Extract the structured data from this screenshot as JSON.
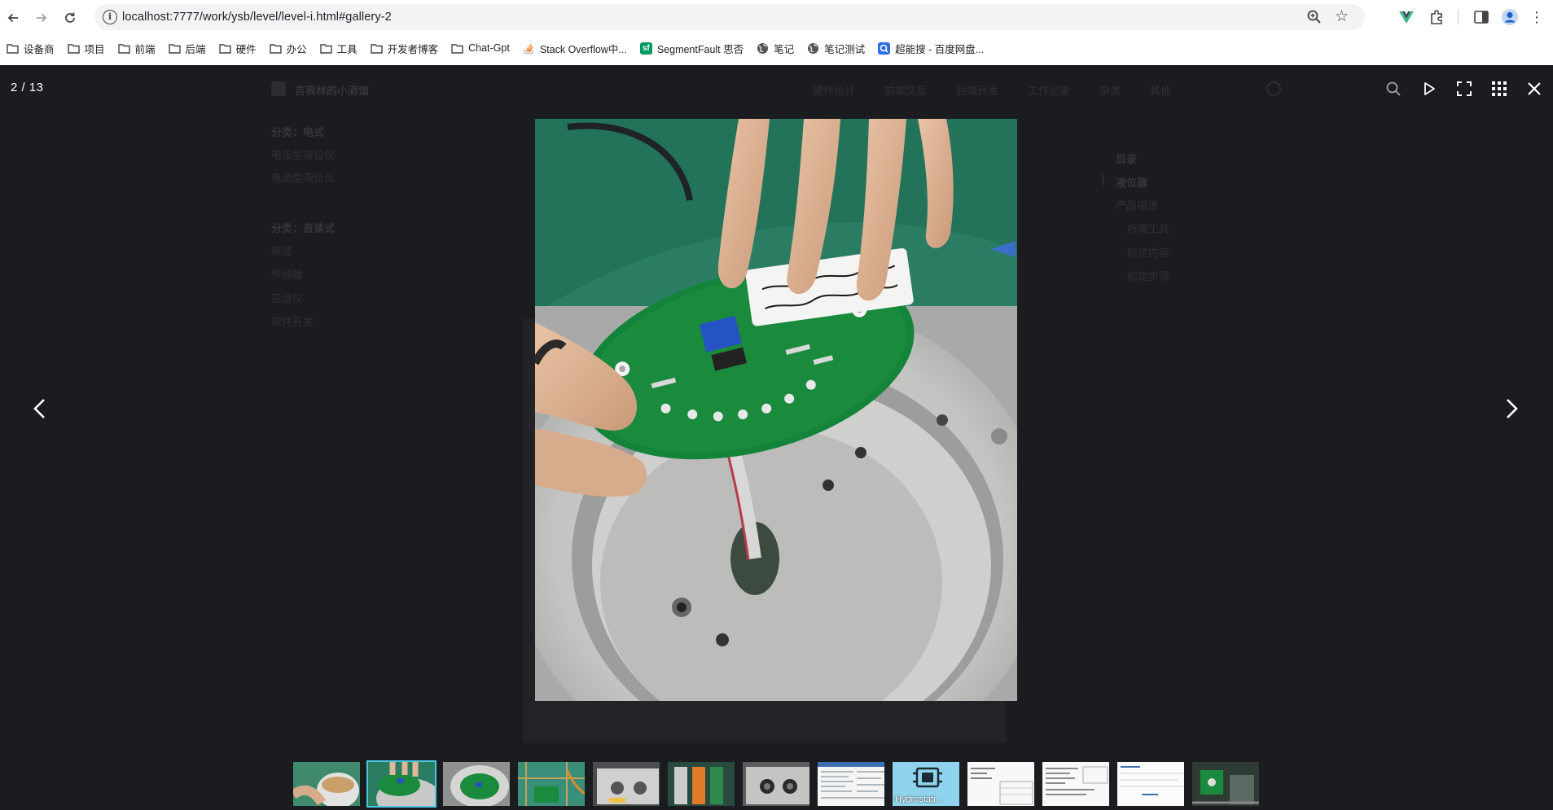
{
  "browser": {
    "url": "localhost:7777/work/ysb/level/level-i.html#gallery-2",
    "bookmarks": [
      {
        "label": "设备商",
        "icon": "folder-icon"
      },
      {
        "label": "项目",
        "icon": "folder-icon"
      },
      {
        "label": "前端",
        "icon": "folder-icon"
      },
      {
        "label": "后端",
        "icon": "folder-icon"
      },
      {
        "label": "硬件",
        "icon": "folder-icon"
      },
      {
        "label": "办公",
        "icon": "folder-icon"
      },
      {
        "label": "工具",
        "icon": "folder-icon"
      },
      {
        "label": "开发者博客",
        "icon": "folder-icon"
      },
      {
        "label": "Chat-Gpt",
        "icon": "folder-icon"
      },
      {
        "label": "Stack Overflow中...",
        "icon": "stackoverflow-icon",
        "color": "#f48024"
      },
      {
        "label": "SegmentFault 思否",
        "icon": "segmentfault-icon",
        "color": "#009a61"
      },
      {
        "label": "笔记",
        "icon": "globe-icon"
      },
      {
        "label": "笔记测试",
        "icon": "globe-icon"
      },
      {
        "label": "超能搜 - 百度网盘...",
        "icon": "search-engine-icon",
        "color": "#2b6de5"
      }
    ]
  },
  "page_behind": {
    "site_title": "吉我林的小酒馆",
    "nav_items": [
      "硬件设计",
      "前端交互",
      "后端开发",
      "工作记录",
      "杂类",
      "其他"
    ],
    "sidebar_groups": [
      {
        "title": "分类：电式",
        "items": [
          "电压型液位仪",
          "电流型液位仪"
        ]
      },
      {
        "title": "分类：直读式",
        "items": [
          "概述",
          "传感器",
          "变送仪",
          "软件开发"
        ]
      }
    ],
    "toc_title": "目录",
    "toc_items": [
      "液位器",
      "产品描述",
      "所需工具",
      "标定内容",
      "标定步骤"
    ]
  },
  "lightbox": {
    "counter": "2 / 13",
    "current_index": 2,
    "total": 13,
    "thumbnail_label_9": "Hydrostati..."
  },
  "colors": {
    "overlay": "#1e1f22",
    "active_thumb_border": "#4bc7e6",
    "pcb_green": "#1a8a3d",
    "background_green": "#2d7a60"
  }
}
